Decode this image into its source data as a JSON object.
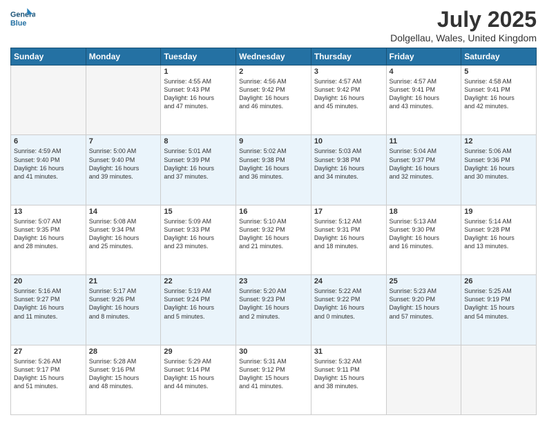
{
  "header": {
    "logo_line1": "General",
    "logo_line2": "Blue",
    "month": "July 2025",
    "location": "Dolgellau, Wales, United Kingdom"
  },
  "weekdays": [
    "Sunday",
    "Monday",
    "Tuesday",
    "Wednesday",
    "Thursday",
    "Friday",
    "Saturday"
  ],
  "rows": [
    {
      "style": "normal",
      "days": [
        {
          "num": "",
          "info": ""
        },
        {
          "num": "",
          "info": ""
        },
        {
          "num": "1",
          "info": "Sunrise: 4:55 AM\nSunset: 9:43 PM\nDaylight: 16 hours\nand 47 minutes."
        },
        {
          "num": "2",
          "info": "Sunrise: 4:56 AM\nSunset: 9:42 PM\nDaylight: 16 hours\nand 46 minutes."
        },
        {
          "num": "3",
          "info": "Sunrise: 4:57 AM\nSunset: 9:42 PM\nDaylight: 16 hours\nand 45 minutes."
        },
        {
          "num": "4",
          "info": "Sunrise: 4:57 AM\nSunset: 9:41 PM\nDaylight: 16 hours\nand 43 minutes."
        },
        {
          "num": "5",
          "info": "Sunrise: 4:58 AM\nSunset: 9:41 PM\nDaylight: 16 hours\nand 42 minutes."
        }
      ]
    },
    {
      "style": "alt",
      "days": [
        {
          "num": "6",
          "info": "Sunrise: 4:59 AM\nSunset: 9:40 PM\nDaylight: 16 hours\nand 41 minutes."
        },
        {
          "num": "7",
          "info": "Sunrise: 5:00 AM\nSunset: 9:40 PM\nDaylight: 16 hours\nand 39 minutes."
        },
        {
          "num": "8",
          "info": "Sunrise: 5:01 AM\nSunset: 9:39 PM\nDaylight: 16 hours\nand 37 minutes."
        },
        {
          "num": "9",
          "info": "Sunrise: 5:02 AM\nSunset: 9:38 PM\nDaylight: 16 hours\nand 36 minutes."
        },
        {
          "num": "10",
          "info": "Sunrise: 5:03 AM\nSunset: 9:38 PM\nDaylight: 16 hours\nand 34 minutes."
        },
        {
          "num": "11",
          "info": "Sunrise: 5:04 AM\nSunset: 9:37 PM\nDaylight: 16 hours\nand 32 minutes."
        },
        {
          "num": "12",
          "info": "Sunrise: 5:06 AM\nSunset: 9:36 PM\nDaylight: 16 hours\nand 30 minutes."
        }
      ]
    },
    {
      "style": "normal",
      "days": [
        {
          "num": "13",
          "info": "Sunrise: 5:07 AM\nSunset: 9:35 PM\nDaylight: 16 hours\nand 28 minutes."
        },
        {
          "num": "14",
          "info": "Sunrise: 5:08 AM\nSunset: 9:34 PM\nDaylight: 16 hours\nand 25 minutes."
        },
        {
          "num": "15",
          "info": "Sunrise: 5:09 AM\nSunset: 9:33 PM\nDaylight: 16 hours\nand 23 minutes."
        },
        {
          "num": "16",
          "info": "Sunrise: 5:10 AM\nSunset: 9:32 PM\nDaylight: 16 hours\nand 21 minutes."
        },
        {
          "num": "17",
          "info": "Sunrise: 5:12 AM\nSunset: 9:31 PM\nDaylight: 16 hours\nand 18 minutes."
        },
        {
          "num": "18",
          "info": "Sunrise: 5:13 AM\nSunset: 9:30 PM\nDaylight: 16 hours\nand 16 minutes."
        },
        {
          "num": "19",
          "info": "Sunrise: 5:14 AM\nSunset: 9:28 PM\nDaylight: 16 hours\nand 13 minutes."
        }
      ]
    },
    {
      "style": "alt",
      "days": [
        {
          "num": "20",
          "info": "Sunrise: 5:16 AM\nSunset: 9:27 PM\nDaylight: 16 hours\nand 11 minutes."
        },
        {
          "num": "21",
          "info": "Sunrise: 5:17 AM\nSunset: 9:26 PM\nDaylight: 16 hours\nand 8 minutes."
        },
        {
          "num": "22",
          "info": "Sunrise: 5:19 AM\nSunset: 9:24 PM\nDaylight: 16 hours\nand 5 minutes."
        },
        {
          "num": "23",
          "info": "Sunrise: 5:20 AM\nSunset: 9:23 PM\nDaylight: 16 hours\nand 2 minutes."
        },
        {
          "num": "24",
          "info": "Sunrise: 5:22 AM\nSunset: 9:22 PM\nDaylight: 16 hours\nand 0 minutes."
        },
        {
          "num": "25",
          "info": "Sunrise: 5:23 AM\nSunset: 9:20 PM\nDaylight: 15 hours\nand 57 minutes."
        },
        {
          "num": "26",
          "info": "Sunrise: 5:25 AM\nSunset: 9:19 PM\nDaylight: 15 hours\nand 54 minutes."
        }
      ]
    },
    {
      "style": "normal",
      "days": [
        {
          "num": "27",
          "info": "Sunrise: 5:26 AM\nSunset: 9:17 PM\nDaylight: 15 hours\nand 51 minutes."
        },
        {
          "num": "28",
          "info": "Sunrise: 5:28 AM\nSunset: 9:16 PM\nDaylight: 15 hours\nand 48 minutes."
        },
        {
          "num": "29",
          "info": "Sunrise: 5:29 AM\nSunset: 9:14 PM\nDaylight: 15 hours\nand 44 minutes."
        },
        {
          "num": "30",
          "info": "Sunrise: 5:31 AM\nSunset: 9:12 PM\nDaylight: 15 hours\nand 41 minutes."
        },
        {
          "num": "31",
          "info": "Sunrise: 5:32 AM\nSunset: 9:11 PM\nDaylight: 15 hours\nand 38 minutes."
        },
        {
          "num": "",
          "info": ""
        },
        {
          "num": "",
          "info": ""
        }
      ]
    }
  ]
}
